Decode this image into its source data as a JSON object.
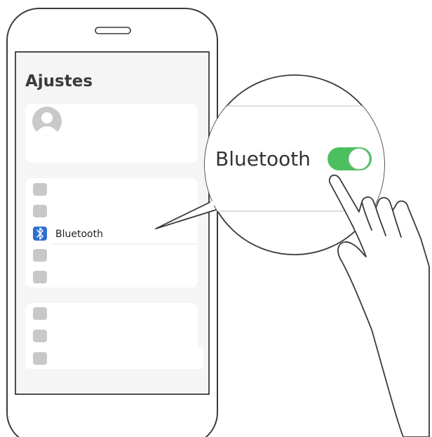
{
  "screen": {
    "title": "Ajustes",
    "highlighted_row_label": "Bluetooth"
  },
  "zoom": {
    "label": "Bluetooth",
    "toggle_state": "on"
  },
  "colors": {
    "toggle_on": "#4cc05f",
    "bluetooth_icon_bg": "#2f6fd0",
    "outline": "#3a3a3a",
    "screen_bg": "#f4f5f4",
    "card_bg": "#ffffff",
    "placeholder_icon": "#c8c8c8"
  },
  "icons": {
    "avatar": "user-avatar-icon",
    "bluetooth": "bluetooth-icon",
    "hand": "pointing-hand-icon"
  }
}
